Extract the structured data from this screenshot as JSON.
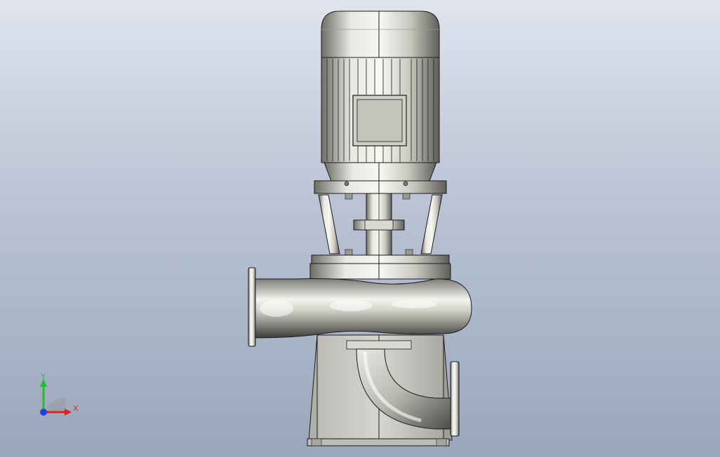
{
  "viewport": {
    "background_top": "#dfe4ee",
    "background_bottom": "#9aa6bb"
  },
  "model": {
    "metal_light": "#f2f2ee",
    "metal_mid": "#c9c8c0",
    "metal_dark": "#6e6d68",
    "outline": "#1b1b1b",
    "base_color": "#c8c8c2"
  },
  "triad": {
    "x_label": "X",
    "y_label": "Y",
    "x_color": "#e02020",
    "y_color": "#20c030",
    "z_color": "#2040e0"
  }
}
